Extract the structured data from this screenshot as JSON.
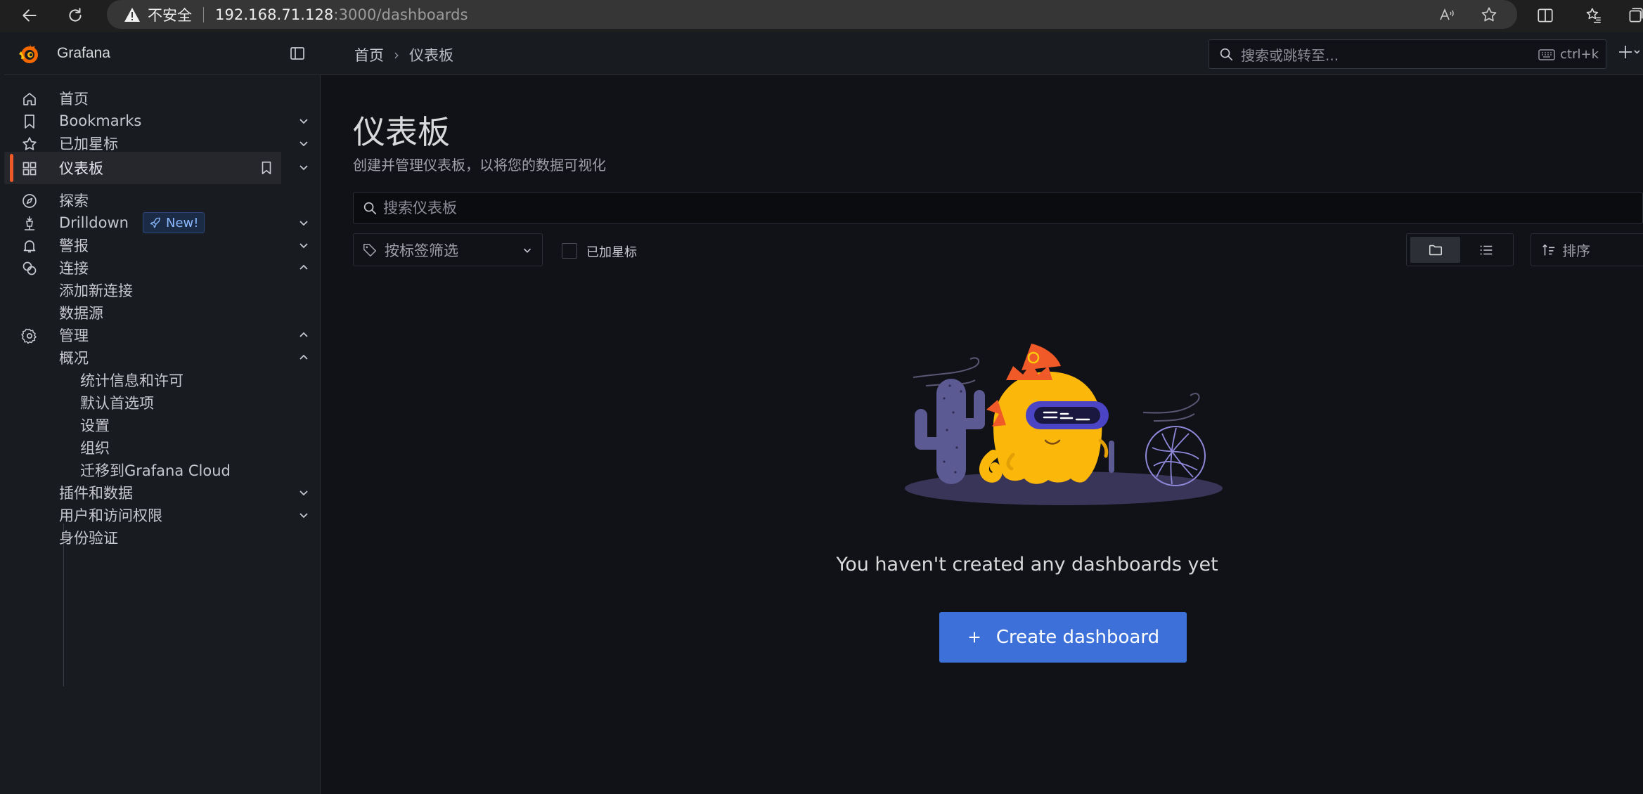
{
  "browser": {
    "security_text": "不安全",
    "url_host": "192.168.71.128",
    "url_rest": ":3000/dashboards"
  },
  "app": {
    "name": "Grafana",
    "brand_color": "#f05a28",
    "accent_color": "#3d71d9"
  },
  "breadcrumb": {
    "home": "首页",
    "separator": "›",
    "current": "仪表板"
  },
  "top_search": {
    "placeholder": "搜索或跳转至...",
    "shortcut": "ctrl+k"
  },
  "sidebar": {
    "items": [
      {
        "label": "首页",
        "icon": "home-icon"
      },
      {
        "label": "Bookmarks",
        "icon": "bookmark-icon"
      },
      {
        "label": "已加星标",
        "icon": "star-icon"
      },
      {
        "label": "仪表板",
        "icon": "apps-icon"
      },
      {
        "label": "探索",
        "icon": "compass-icon"
      },
      {
        "label": "Drilldown",
        "icon": "drilldown-icon",
        "badge": "New!"
      },
      {
        "label": "警报",
        "icon": "bell-icon"
      },
      {
        "label": "连接",
        "icon": "connections-icon"
      },
      {
        "label": "添加新连接"
      },
      {
        "label": "数据源"
      },
      {
        "label": "管理",
        "icon": "cog-icon"
      },
      {
        "label": "概况"
      },
      {
        "label": "统计信息和许可"
      },
      {
        "label": "默认首选项"
      },
      {
        "label": "设置"
      },
      {
        "label": "组织"
      },
      {
        "label": "迁移到Grafana Cloud"
      },
      {
        "label": "插件和数据"
      },
      {
        "label": "用户和访问权限"
      },
      {
        "label": "身份验证"
      }
    ]
  },
  "main": {
    "title": "仪表板",
    "subtitle": "创建并管理仪表板，以将您的数据可视化",
    "search_placeholder": "搜索仪表板",
    "tag_filter": "按标签筛选",
    "starred_label": "已加星标",
    "sort_label": "排序",
    "empty_message": "You haven't created any dashboards yet",
    "create_button": "Create dashboard"
  }
}
